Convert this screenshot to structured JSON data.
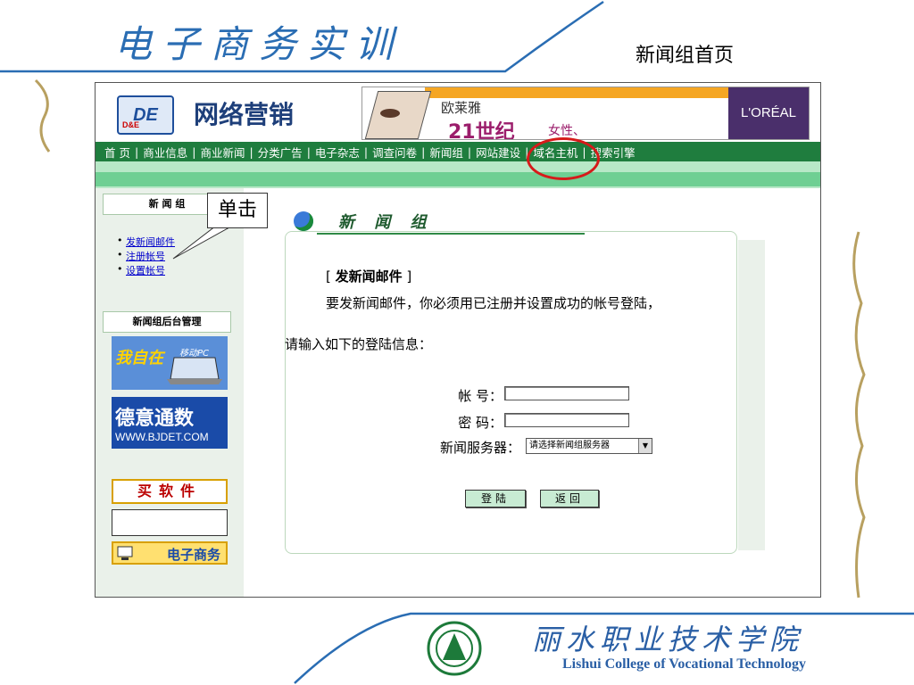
{
  "slide": {
    "title": "电子商务实训",
    "subtitle": "新闻组首页",
    "college_cn": "丽水职业技术学院",
    "college_en": "Lishui College of Vocational Technology",
    "callout": "单击"
  },
  "site": {
    "logo_badge": "DE",
    "logo_sub": "D&E",
    "logo_text": "网络营销",
    "ad": {
      "brand": "欧莱雅",
      "slogan": "21世纪",
      "slogan2": "女性、",
      "logo": "L'ORÉAL"
    },
    "nav": [
      {
        "label": "首  页"
      },
      {
        "label": "商业信息"
      },
      {
        "label": "商业新闻"
      },
      {
        "label": "分类广告"
      },
      {
        "label": "电子杂志"
      },
      {
        "label": "调查问卷"
      },
      {
        "label": "新闻组"
      },
      {
        "label": "网站建设"
      },
      {
        "label": "域名主机"
      },
      {
        "label": "搜索引擎"
      }
    ]
  },
  "sidebar": {
    "section1_title": "新 闻 组",
    "links": [
      {
        "label": "发新闻邮件"
      },
      {
        "label": "注册帐号"
      },
      {
        "label": "设置帐号"
      }
    ],
    "section2_title": "新闻组后台管理",
    "promo1_t1": "我自在",
    "promo1_t2": "移动PC",
    "promo2_t1": "德意通数",
    "promo2_t2": "WWW.BJDET.COM",
    "promo3": "买软件",
    "promo5": "电子商务"
  },
  "main": {
    "title": "新 闻 组",
    "compose_open": "[  ",
    "compose_label": "发新闻邮件",
    "compose_close": "  ]",
    "instruction": "要发新闻邮件，你必须用已注册并设置成功的帐号登陆，",
    "prompt": "请输入如下的登陆信息：",
    "account_label": "帐  号：",
    "password_label": "密  码：",
    "server_label": "新闻服务器：",
    "server_value": "请选择新闻组服务器",
    "login_button": "登陆",
    "back_button": "返回"
  },
  "colors": {
    "nav_green": "#1f7d3e",
    "band_green": "#6fcf93",
    "highlight_red": "#d61a1a",
    "title_blue": "#2a6db3"
  }
}
